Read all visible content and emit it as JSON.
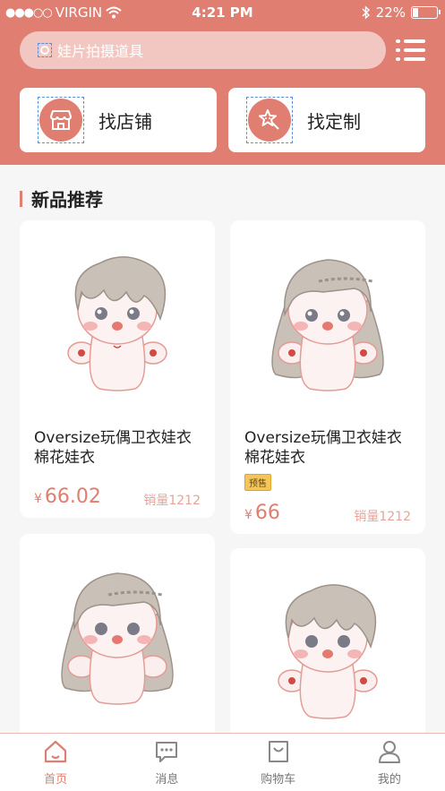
{
  "status_bar": {
    "signal": "●●●○○",
    "carrier": "VIRGIN",
    "time": "4:21 PM",
    "battery": "22%",
    "battery_level": 0.22
  },
  "search": {
    "placeholder": "娃片拍摄道具"
  },
  "entries": [
    {
      "label": "找店铺",
      "icon": "store-icon"
    },
    {
      "label": "找定制",
      "icon": "custom-star-icon"
    }
  ],
  "section": {
    "title": "新品推荐"
  },
  "products": [
    {
      "name_line1": "Oversize玩偶卫衣娃衣",
      "name_line2": "棉花娃衣",
      "currency": "¥",
      "price": "66.02",
      "sales": "销量1212",
      "tag": "",
      "doll": "short-hair"
    },
    {
      "name_line1": "Oversize玩偶卫衣娃衣",
      "name_line2": "棉花娃衣",
      "currency": "¥",
      "price": "66",
      "sales": "销量1212",
      "tag": "预售",
      "doll": "long-hair"
    },
    {
      "doll": "long-hair"
    },
    {
      "doll": "short-hair"
    }
  ],
  "tabbar": [
    {
      "label": "首页",
      "icon": "home-icon",
      "active": true
    },
    {
      "label": "消息",
      "icon": "message-icon",
      "active": false
    },
    {
      "label": "购物车",
      "icon": "cart-bag-icon",
      "active": false
    },
    {
      "label": "我的",
      "icon": "profile-icon",
      "active": false
    }
  ],
  "colors": {
    "accent": "#e07e72",
    "search_bg": "#f3c7c1",
    "tag": "#f4c65a"
  }
}
